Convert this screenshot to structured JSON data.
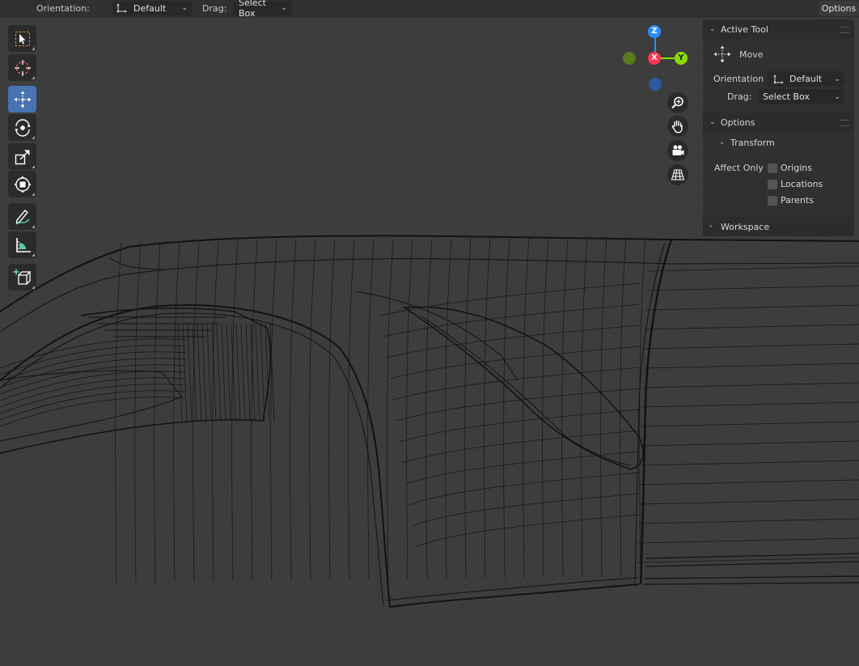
{
  "header": {
    "orientation_label": "Orientation:",
    "orientation_value": "Default",
    "drag_label": "Drag:",
    "drag_value": "Select Box",
    "options_label": "Options"
  },
  "toolbar": {
    "tools": [
      {
        "name": "select-box",
        "icon": "select-box-icon",
        "active": false
      },
      {
        "name": "cursor",
        "icon": "cursor-icon",
        "active": false
      },
      {
        "name": "move",
        "icon": "move-icon",
        "active": true
      },
      {
        "name": "rotate",
        "icon": "rotate-icon",
        "active": false
      },
      {
        "name": "scale",
        "icon": "scale-icon",
        "active": false
      },
      {
        "name": "transform",
        "icon": "transform-icon",
        "active": false
      },
      {
        "name": "annotate",
        "icon": "annotate-icon",
        "active": false
      },
      {
        "name": "measure",
        "icon": "measure-icon",
        "active": false
      },
      {
        "name": "add-cube",
        "icon": "add-cube-icon",
        "active": false
      }
    ]
  },
  "gizmo": {
    "z_label": "Z",
    "x_label": "X",
    "y_label": "Y",
    "colors": {
      "x": "#ff3352",
      "y": "#8bdc00",
      "z": "#2890ff",
      "neg_y": "#5a7a20",
      "neg_z": "#2c5aa0"
    }
  },
  "navigation": [
    {
      "icon": "zoom-icon"
    },
    {
      "icon": "pan-hand-icon"
    },
    {
      "icon": "camera-icon"
    },
    {
      "icon": "perspective-grid-icon"
    }
  ],
  "sidebar": {
    "active_tool": {
      "title": "Active Tool",
      "tool_name": "Move",
      "orientation_label": "Orientation",
      "orientation_value": "Default",
      "drag_label": "Drag:",
      "drag_value": "Select Box"
    },
    "options": {
      "title": "Options",
      "transform_title": "Transform",
      "affect_only_label": "Affect Only",
      "checkboxes": [
        {
          "label": "Origins",
          "checked": false
        },
        {
          "label": "Locations",
          "checked": false
        },
        {
          "label": "Parents",
          "checked": false
        }
      ]
    },
    "workspace": {
      "title": "Workspace"
    }
  },
  "colors": {
    "accent": "#4772b3",
    "viewport_bg": "#3d3d3d",
    "wire": "#0f0f0f"
  }
}
